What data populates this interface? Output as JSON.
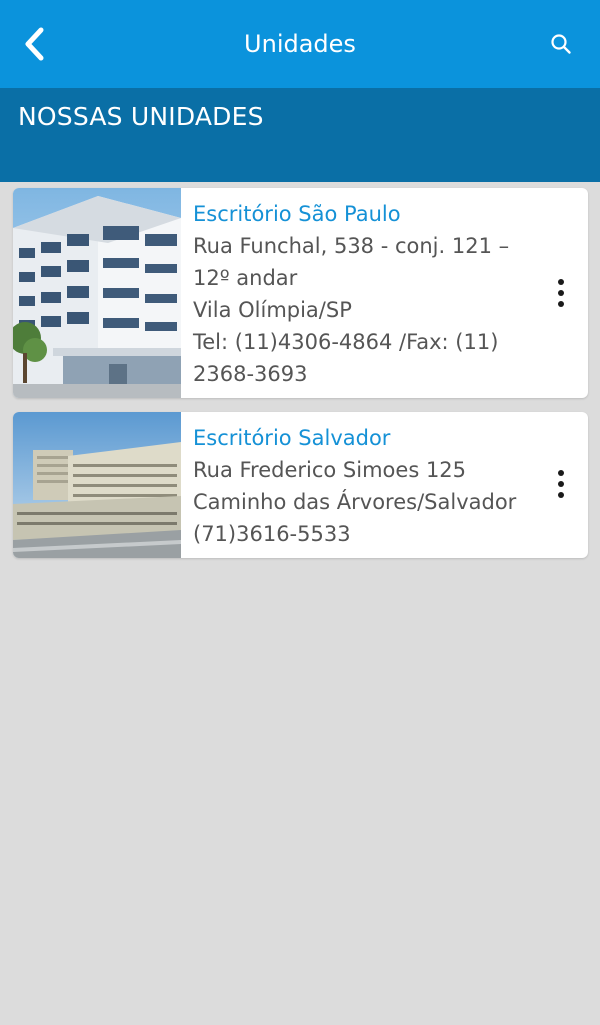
{
  "app_bar": {
    "title": "Unidades",
    "back_icon": "chevron-left-icon",
    "search_icon": "search-icon",
    "color": "#0b93dc"
  },
  "section": {
    "title": "NOSSAS UNIDADES",
    "color": "#0a6fa6"
  },
  "units": [
    {
      "title": "Escritório São Paulo",
      "lines": [
        "Rua Funchal, 538 - conj. 121 –",
        "12º andar",
        "Vila Olímpia/SP",
        "Tel: (11)4306-4864 /Fax: (11)",
        "2368-3693"
      ],
      "menu_icon": "more-vertical-icon"
    },
    {
      "title": "Escritório Salvador",
      "lines": [
        "Rua Frederico Simoes 125",
        "Caminho das Árvores/Salvador",
        "(71)3616-5533"
      ],
      "menu_icon": "more-vertical-icon"
    }
  ]
}
